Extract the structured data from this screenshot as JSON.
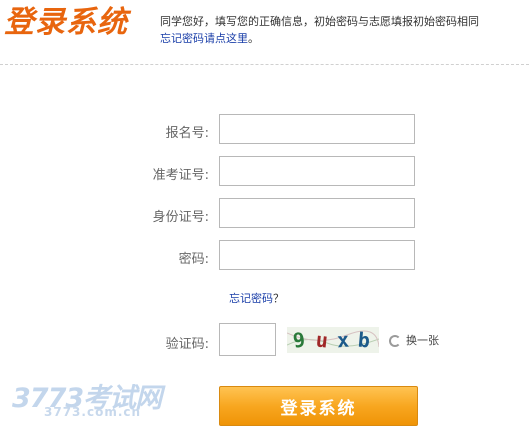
{
  "header": {
    "title": "登录系统",
    "message_line1": "同学您好，填写您的正确信息，初始密码与志愿填报初始密码相同",
    "forgot_link": "忘记密码请点这里",
    "forgot_suffix": "。"
  },
  "form": {
    "fields": [
      {
        "label": "报名号:",
        "value": ""
      },
      {
        "label": "准考证号:",
        "value": ""
      },
      {
        "label": "身份证号:",
        "value": ""
      },
      {
        "label": "密码:",
        "value": ""
      }
    ],
    "forgot_password_link": "忘记密码",
    "forgot_password_suffix": "？",
    "captcha": {
      "label": "验证码:",
      "value": "",
      "image_chars": [
        "9",
        "u",
        "x",
        "b"
      ],
      "refresh_label": "换一张"
    },
    "submit_label": "登录系统"
  },
  "watermark": {
    "main": "3773考试网",
    "sub": "3773.com.cn"
  },
  "colors": {
    "accent_orange": "#e8650e",
    "link_blue": "#1a3ea8",
    "button_orange": "#f8a720",
    "captcha_chars": [
      "#2a7a3a",
      "#a02828",
      "#1c5a8a",
      "#1c5a8a"
    ]
  }
}
